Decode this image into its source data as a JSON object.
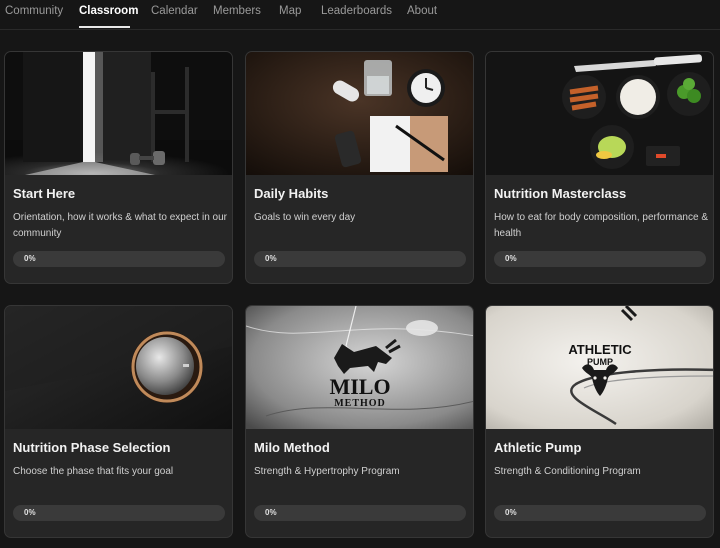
{
  "nav": {
    "tabs": [
      {
        "label": "Community"
      },
      {
        "label": "Classroom"
      },
      {
        "label": "Calendar"
      },
      {
        "label": "Members"
      },
      {
        "label": "Map"
      },
      {
        "label": "Leaderboards"
      },
      {
        "label": "About"
      }
    ],
    "active": "Classroom"
  },
  "courses": [
    {
      "title": "Start Here",
      "description": "Orientation, how it works & what to expect in our community",
      "progress_label": "0%",
      "progress": 0
    },
    {
      "title": "Daily Habits",
      "description": "Goals to win every day",
      "progress_label": "0%",
      "progress": 0
    },
    {
      "title": "Nutrition Masterclass",
      "description": "How to eat for body composition, performance & health",
      "progress_label": "0%",
      "progress": 0
    },
    {
      "title": "Nutrition Phase Selection",
      "description": "Choose the phase that fits your goal",
      "progress_label": "0%",
      "progress": 0
    },
    {
      "title": "Milo Method",
      "description": "Strength & Hypertrophy Program",
      "progress_label": "0%",
      "progress": 0,
      "logo_line1": "MILO",
      "logo_line2": "METHOD"
    },
    {
      "title": "Athletic Pump",
      "description": "Strength & Conditioning Program",
      "progress_label": "0%",
      "progress": 0,
      "logo_line1": "ATHLETIC",
      "logo_line2": "PUMP"
    }
  ]
}
